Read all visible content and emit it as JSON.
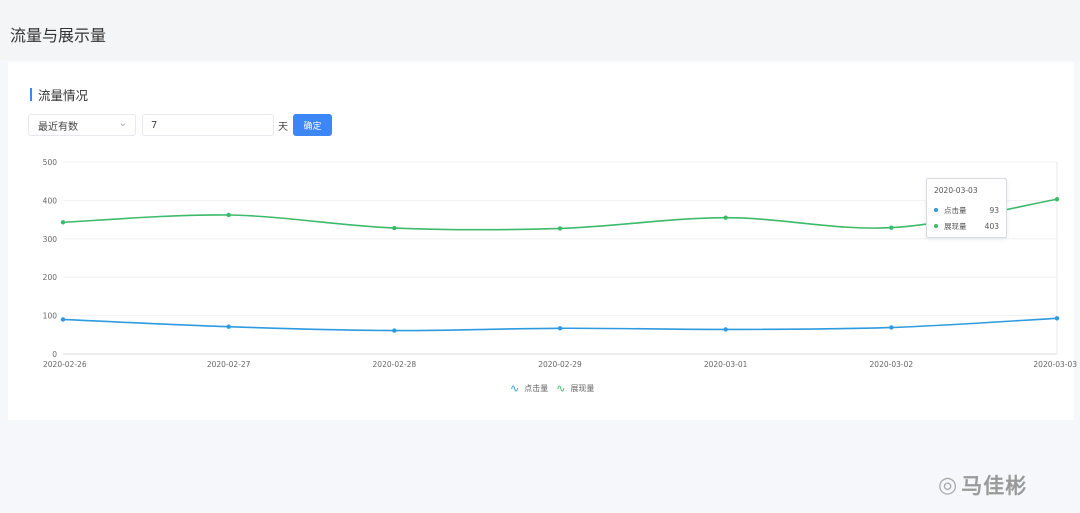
{
  "page": {
    "title": "流量与展示量"
  },
  "section": {
    "title": "流量情况"
  },
  "filters": {
    "select_value": "最近有数",
    "days_value": "7",
    "unit": "天",
    "confirm_label": "确定"
  },
  "colors": {
    "accent": "#3d86f5",
    "click": "#2e9ae0",
    "impression": "#3dba6a"
  },
  "chart_data": {
    "type": "line",
    "categories": [
      "2020-02-26",
      "2020-02-27",
      "2020-02-28",
      "2020-02-29",
      "2020-03-01",
      "2020-03-02",
      "2020-03-03"
    ],
    "series": [
      {
        "name": "点击量",
        "values": [
          90,
          71,
          61,
          67,
          64,
          69,
          93
        ]
      },
      {
        "name": "展现量",
        "values": [
          343,
          362,
          328,
          327,
          355,
          329,
          403
        ]
      }
    ],
    "yticks": [
      "0",
      "100",
      "200",
      "300",
      "400",
      "500"
    ],
    "ylim": [
      0,
      500
    ],
    "grid": true,
    "smooth": true,
    "legend": "bottom-center"
  },
  "tooltip": {
    "title": "2020-03-03",
    "rows": [
      {
        "name": "点击量",
        "value": "93"
      },
      {
        "name": "展现量",
        "value": "403"
      }
    ]
  },
  "watermark": {
    "logo": "weibo-logo-icon",
    "name": "马佳彬"
  }
}
